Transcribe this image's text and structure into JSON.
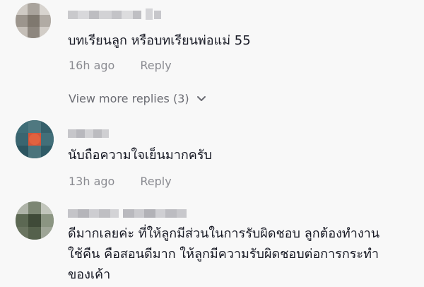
{
  "comments": [
    {
      "text": "บทเรียนลูก หรือบทเรียนพ่อแม่ 55",
      "time": "16h ago",
      "reply_label": "Reply",
      "avatar_icon": "blurred-avatar",
      "username_state": "blurred"
    },
    {
      "text": "นับถือความใจเย็นมากครับ",
      "time": "13h ago",
      "reply_label": "Reply",
      "avatar_icon": "blurred-avatar",
      "username_state": "blurred"
    },
    {
      "text_lines": [
        "ดีมากเลยค่ะ ที่ให้ลูกมีส่วนในการรับผิดชอบ ลูกต้องทำงาน",
        "ใช้คืน คือสอนดีมาก ให้ลูกมีความรับผิดชอบต่อการกระทำ",
        "ของเค้า"
      ],
      "avatar_icon": "blurred-avatar",
      "username_state": "blurred"
    }
  ],
  "view_more_replies": {
    "label": "View more replies (3)",
    "icon": "chevron-down-icon"
  },
  "colors": {
    "background": "#f8f8f8",
    "text": "#161823",
    "muted": "#8a8b91"
  }
}
